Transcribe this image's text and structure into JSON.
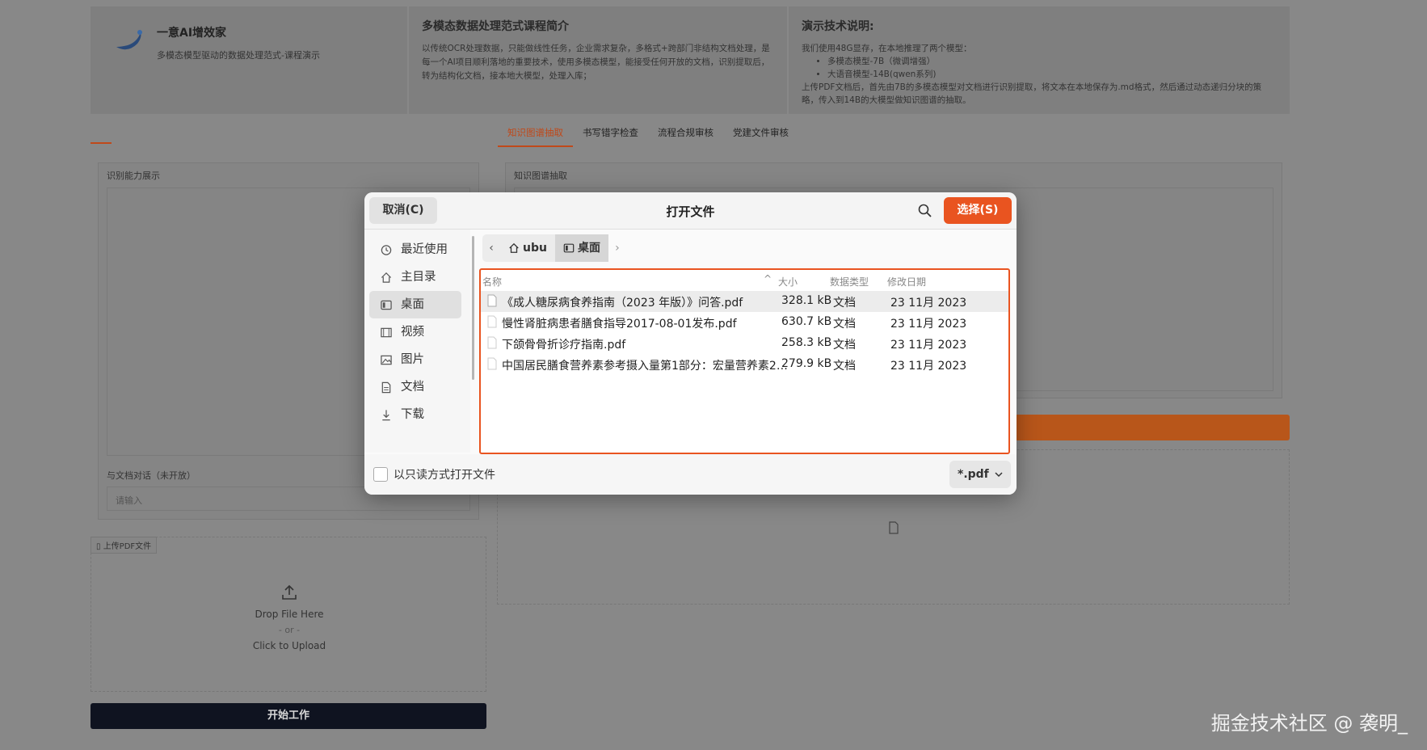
{
  "header": {
    "brand_name": "一意AI增效家",
    "brand_sub": "多模态模型驱动的数据处理范式-课程演示",
    "intro_title": "多模态数据处理范式课程简介",
    "intro_text": "以传统OCR处理数据，只能做线性任务，企业需求复杂，多格式+跨部门非结构文档处理，是每一个AI项目顺利落地的重要技术，使用多模态模型，能接受任何开放的文档，识别提取后，转为结构化文档，接本地大模型，处理入库；",
    "tech_title": "演示技术说明:",
    "tech_line1": "我们使用48G显存，在本地推理了两个模型：",
    "tech_item1": "多模态模型-7B（微调增强）",
    "tech_item2": "大语音模型-14B(qwen系列)",
    "tech_line2": "上传PDF文档后，首先由7B的多模态模型对文档进行识别提取，将文本在本地保存为.md格式，然后通过动态递归分块的策略，传入到14B的大模型做知识图谱的抽取。"
  },
  "tabs": [
    "知识图谱抽取",
    "书写错字检查",
    "流程合规审核",
    "党建文件审核"
  ],
  "left_panel": {
    "label": "识别能力展示",
    "chat_label": "与文档对话（未开放）",
    "chat_placeholder": "请输入"
  },
  "right_panel": {
    "label": "知识图谱抽取"
  },
  "upload": {
    "tag": "上传PDF文件",
    "drop": "Drop File Here",
    "or": "- or -",
    "click": "Click to Upload"
  },
  "start_button": "开始工作",
  "watermark": "掘金技术社区 @ 袭明_",
  "dialog": {
    "cancel": "取消(C)",
    "title": "打开文件",
    "select": "选择(S)",
    "sidebar": [
      {
        "label": "最近使用",
        "icon": "recent-icon"
      },
      {
        "label": "主目录",
        "icon": "home-icon"
      },
      {
        "label": "桌面",
        "icon": "desktop-icon"
      },
      {
        "label": "视频",
        "icon": "video-icon"
      },
      {
        "label": "图片",
        "icon": "picture-icon"
      },
      {
        "label": "文档",
        "icon": "document-icon"
      },
      {
        "label": "下载",
        "icon": "download-icon"
      }
    ],
    "path": [
      "ubu",
      "桌面"
    ],
    "columns": {
      "name": "名称",
      "size": "大小",
      "type": "数据类型",
      "modified": "修改日期"
    },
    "files": [
      {
        "name": "《成人糖尿病食养指南（2023 年版）》问答.pdf",
        "size": "328.1 kB",
        "type": "文档",
        "modified": "23 11月 2023"
      },
      {
        "name": "慢性肾脏病患者膳食指导2017-08-01发布.pdf",
        "size": "630.7 kB",
        "type": "文档",
        "modified": "23 11月 2023"
      },
      {
        "name": "下颌骨骨折诊疗指南.pdf",
        "size": "258.3 kB",
        "type": "文档",
        "modified": "23 11月 2023"
      },
      {
        "name": "中国居民膳食营养素参考摄入量第1部分：宏量营养素2…",
        "size": "279.9 kB",
        "type": "文档",
        "modified": "23 11月 2023"
      }
    ],
    "readonly_label": "以只读方式打开文件",
    "filter": "*.pdf"
  }
}
